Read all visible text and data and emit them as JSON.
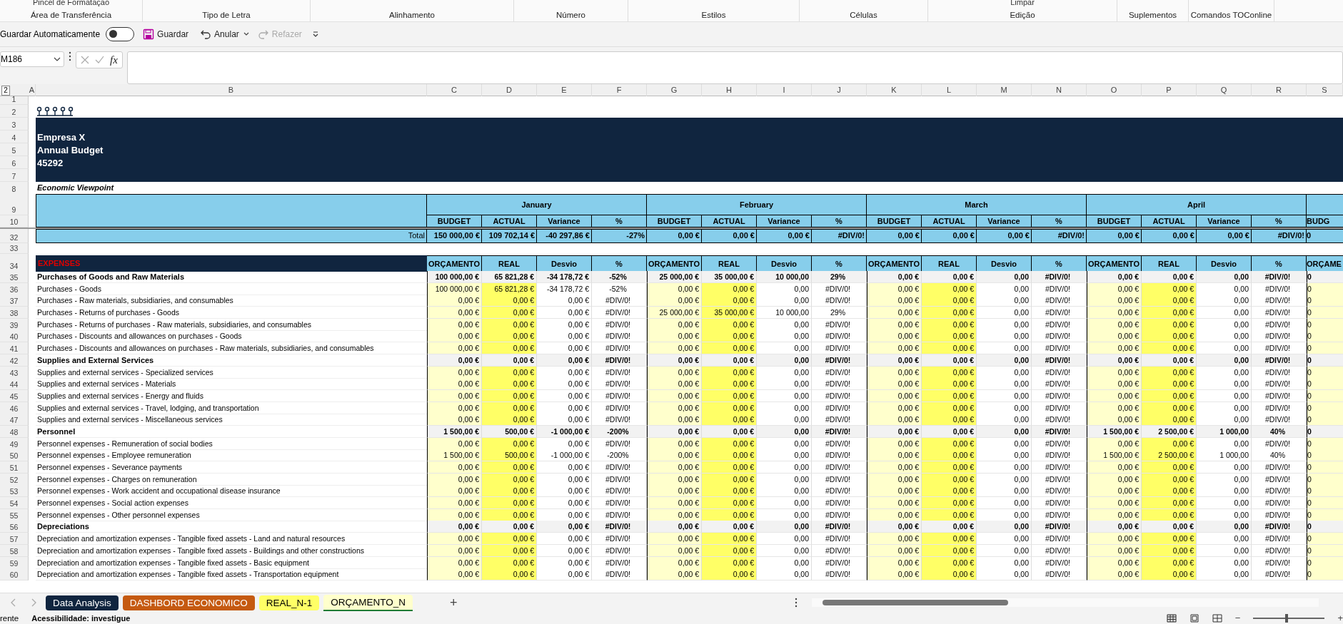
{
  "ribbon": {
    "groups": [
      {
        "label": "Área de Transferência",
        "top_label": "Pincel de Formatação"
      },
      {
        "label": "Tipo de Letra"
      },
      {
        "label": "Alinhamento"
      },
      {
        "label": "Número"
      },
      {
        "label": "Estilos"
      },
      {
        "label": "Células"
      },
      {
        "label": "Edição",
        "top_label": "Limpar"
      },
      {
        "label": "Suplementos"
      },
      {
        "label": "Comandos TOConline"
      }
    ]
  },
  "quick_access": {
    "autosave_label": "Guardar Automaticamente",
    "autosave_on": false,
    "save": "Guardar",
    "undo": "Anular",
    "redo": "Refazer",
    "redo_disabled": true
  },
  "formula_bar": {
    "name_box": "M186",
    "fx": "fx"
  },
  "outline_level": "2",
  "columns": [
    "A",
    "B",
    "C",
    "D",
    "E",
    "F",
    "G",
    "H",
    "I",
    "J",
    "K",
    "L",
    "M",
    "N",
    "O",
    "P",
    "Q",
    "R",
    "S"
  ],
  "top_rows": [
    {
      "number": "1",
      "kind": "blank"
    },
    {
      "number": "2",
      "kind": "logo"
    },
    {
      "number": "3",
      "kind": "banner"
    },
    {
      "number": "4",
      "kind": "banner",
      "text": "Empresa X"
    },
    {
      "number": "5",
      "kind": "banner",
      "text": "Annual Budget"
    },
    {
      "number": "6",
      "kind": "banner",
      "text": "45292"
    },
    {
      "number": "7",
      "kind": "banner"
    },
    {
      "number": "8",
      "kind": "caption",
      "text": "Economic Viewpoint"
    }
  ],
  "month_header": {
    "number": "9",
    "months": [
      "January",
      "February",
      "March",
      "April"
    ]
  },
  "sub_header": {
    "number": "10",
    "cells": [
      "BUDGET",
      "ACTUAL",
      "Variance",
      "%",
      "BUDGET",
      "ACTUAL",
      "Variance",
      "%",
      "BUDGET",
      "ACTUAL",
      "Variance",
      "%",
      "BUDGET",
      "ACTUAL",
      "Variance",
      "%",
      "BUDG"
    ]
  },
  "total_row": {
    "number": "32",
    "label": "Total",
    "cells": [
      "150 000,00 €",
      "109 702,14 €",
      "-40 297,86 €",
      "-27%",
      "0,00 €",
      "0,00 €",
      "0,00 €",
      "#DIV/0!",
      "0,00 €",
      "0,00 €",
      "0,00 €",
      "#DIV/0!",
      "0,00 €",
      "0,00 €",
      "0,00 €",
      "#DIV/0!",
      "0"
    ]
  },
  "blank_row": {
    "number": "33"
  },
  "expenses_header": {
    "number": "34",
    "label": "EXPENSES",
    "cells": [
      "ORÇAMENTO",
      "REAL",
      "Desvio",
      "%",
      "ORÇAMENTO",
      "REAL",
      "Desvio",
      "%",
      "ORÇAMENTO",
      "REAL",
      "Desvio",
      "%",
      "ORÇAMENTO",
      "REAL",
      "Desvio",
      "%",
      "ORÇAME"
    ]
  },
  "rows": [
    {
      "number": "35",
      "kind": "group",
      "label": "Purchases of Goods and Raw Materials",
      "cells": [
        "100 000,00 €",
        "65 821,28 €",
        "-34 178,72 €",
        "-52%",
        "25 000,00 €",
        "35 000,00 €",
        "10 000,00",
        "29%",
        "0,00 €",
        "0,00 €",
        "0,00",
        "#DIV/0!",
        "0,00 €",
        "0,00 €",
        "0,00",
        "#DIV/0!",
        "0"
      ]
    },
    {
      "number": "36",
      "kind": "item",
      "label": "Purchases - Goods",
      "cells": [
        "100 000,00 €",
        "65 821,28 €",
        "-34 178,72 €",
        "-52%",
        "0,00 €",
        "0,00 €",
        "0,00",
        "#DIV/0!",
        "0,00 €",
        "0,00 €",
        "0,00",
        "#DIV/0!",
        "0,00 €",
        "0,00 €",
        "0,00",
        "#DIV/0!",
        "0"
      ]
    },
    {
      "number": "37",
      "kind": "item",
      "label": "Purchases - Raw materials, subsidiaries, and consumables",
      "cells": [
        "0,00 €",
        "0,00 €",
        "0,00 €",
        "#DIV/0!",
        "0,00 €",
        "0,00 €",
        "0,00",
        "#DIV/0!",
        "0,00 €",
        "0,00 €",
        "0,00",
        "#DIV/0!",
        "0,00 €",
        "0,00 €",
        "0,00",
        "#DIV/0!",
        "0"
      ]
    },
    {
      "number": "38",
      "kind": "item",
      "label": "Purchases - Returns of purchases - Goods",
      "cells": [
        "0,00 €",
        "0,00 €",
        "0,00 €",
        "#DIV/0!",
        "25 000,00 €",
        "35 000,00 €",
        "10 000,00",
        "29%",
        "0,00 €",
        "0,00 €",
        "0,00",
        "#DIV/0!",
        "0,00 €",
        "0,00 €",
        "0,00",
        "#DIV/0!",
        "0"
      ]
    },
    {
      "number": "39",
      "kind": "item",
      "label": "Purchases - Returns of purchases - Raw materials, subsidiaries, and consumables",
      "cells": [
        "0,00 €",
        "0,00 €",
        "0,00 €",
        "#DIV/0!",
        "0,00 €",
        "0,00 €",
        "0,00",
        "#DIV/0!",
        "0,00 €",
        "0,00 €",
        "0,00",
        "#DIV/0!",
        "0,00 €",
        "0,00 €",
        "0,00",
        "#DIV/0!",
        "0"
      ]
    },
    {
      "number": "40",
      "kind": "item",
      "label": "Purchases - Discounts and allowances on purchases - Goods",
      "cells": [
        "0,00 €",
        "0,00 €",
        "0,00 €",
        "#DIV/0!",
        "0,00 €",
        "0,00 €",
        "0,00",
        "#DIV/0!",
        "0,00 €",
        "0,00 €",
        "0,00",
        "#DIV/0!",
        "0,00 €",
        "0,00 €",
        "0,00",
        "#DIV/0!",
        "0"
      ]
    },
    {
      "number": "41",
      "kind": "item",
      "label": "Purchases - Discounts and allowances on purchases - Raw materials, subsidiaries, and consumables",
      "cells": [
        "0,00 €",
        "0,00 €",
        "0,00 €",
        "#DIV/0!",
        "0,00 €",
        "0,00 €",
        "0,00",
        "#DIV/0!",
        "0,00 €",
        "0,00 €",
        "0,00",
        "#DIV/0!",
        "0,00 €",
        "0,00 €",
        "0,00",
        "#DIV/0!",
        "0"
      ]
    },
    {
      "number": "42",
      "kind": "group",
      "label": "Supplies and External Services",
      "cells": [
        "0,00 €",
        "0,00 €",
        "0,00 €",
        "#DIV/0!",
        "0,00 €",
        "0,00 €",
        "0,00",
        "#DIV/0!",
        "0,00 €",
        "0,00 €",
        "0,00",
        "#DIV/0!",
        "0,00 €",
        "0,00 €",
        "0,00",
        "#DIV/0!",
        "0"
      ]
    },
    {
      "number": "43",
      "kind": "item",
      "label": "Supplies and external services - Specialized services",
      "cells": [
        "0,00 €",
        "0,00 €",
        "0,00 €",
        "#DIV/0!",
        "0,00 €",
        "0,00 €",
        "0,00",
        "#DIV/0!",
        "0,00 €",
        "0,00 €",
        "0,00",
        "#DIV/0!",
        "0,00 €",
        "0,00 €",
        "0,00",
        "#DIV/0!",
        "0"
      ]
    },
    {
      "number": "44",
      "kind": "item",
      "label": "Supplies and external services - Materials",
      "cells": [
        "0,00 €",
        "0,00 €",
        "0,00 €",
        "#DIV/0!",
        "0,00 €",
        "0,00 €",
        "0,00",
        "#DIV/0!",
        "0,00 €",
        "0,00 €",
        "0,00",
        "#DIV/0!",
        "0,00 €",
        "0,00 €",
        "0,00",
        "#DIV/0!",
        "0"
      ]
    },
    {
      "number": "45",
      "kind": "item",
      "label": "Supplies and external services - Energy and fluids",
      "cells": [
        "0,00 €",
        "0,00 €",
        "0,00 €",
        "#DIV/0!",
        "0,00 €",
        "0,00 €",
        "0,00",
        "#DIV/0!",
        "0,00 €",
        "0,00 €",
        "0,00",
        "#DIV/0!",
        "0,00 €",
        "0,00 €",
        "0,00",
        "#DIV/0!",
        "0"
      ]
    },
    {
      "number": "46",
      "kind": "item",
      "label": "Supplies and external services - Travel, lodging, and transportation",
      "cells": [
        "0,00 €",
        "0,00 €",
        "0,00 €",
        "#DIV/0!",
        "0,00 €",
        "0,00 €",
        "0,00",
        "#DIV/0!",
        "0,00 €",
        "0,00 €",
        "0,00",
        "#DIV/0!",
        "0,00 €",
        "0,00 €",
        "0,00",
        "#DIV/0!",
        "0"
      ]
    },
    {
      "number": "47",
      "kind": "item",
      "label": "Supplies and external services - Miscellaneous services",
      "cells": [
        "0,00 €",
        "0,00 €",
        "0,00 €",
        "#DIV/0!",
        "0,00 €",
        "0,00 €",
        "0,00",
        "#DIV/0!",
        "0,00 €",
        "0,00 €",
        "0,00",
        "#DIV/0!",
        "0,00 €",
        "0,00 €",
        "0,00",
        "#DIV/0!",
        "0"
      ]
    },
    {
      "number": "48",
      "kind": "group",
      "label": "Personnel",
      "cells": [
        "1 500,00 €",
        "500,00 €",
        "-1 000,00 €",
        "-200%",
        "0,00 €",
        "0,00 €",
        "0,00",
        "#DIV/0!",
        "0,00 €",
        "0,00 €",
        "0,00",
        "#DIV/0!",
        "1 500,00 €",
        "2 500,00 €",
        "1 000,00",
        "40%",
        "0"
      ]
    },
    {
      "number": "49",
      "kind": "item",
      "label": "Personnel expenses - Remuneration of social bodies",
      "cells": [
        "0,00 €",
        "0,00 €",
        "0,00 €",
        "#DIV/0!",
        "0,00 €",
        "0,00 €",
        "0,00",
        "#DIV/0!",
        "0,00 €",
        "0,00 €",
        "0,00",
        "#DIV/0!",
        "0,00 €",
        "0,00 €",
        "0,00",
        "#DIV/0!",
        "0"
      ]
    },
    {
      "number": "50",
      "kind": "item",
      "label": "Personnel expenses - Employee remuneration",
      "cells": [
        "1 500,00 €",
        "500,00 €",
        "-1 000,00 €",
        "-200%",
        "0,00 €",
        "0,00 €",
        "0,00",
        "#DIV/0!",
        "0,00 €",
        "0,00 €",
        "0,00",
        "#DIV/0!",
        "1 500,00 €",
        "2 500,00 €",
        "1 000,00",
        "40%",
        "0"
      ]
    },
    {
      "number": "51",
      "kind": "item",
      "label": "Personnel expenses - Severance payments",
      "cells": [
        "0,00 €",
        "0,00 €",
        "0,00 €",
        "#DIV/0!",
        "0,00 €",
        "0,00 €",
        "0,00",
        "#DIV/0!",
        "0,00 €",
        "0,00 €",
        "0,00",
        "#DIV/0!",
        "0,00 €",
        "0,00 €",
        "0,00",
        "#DIV/0!",
        "0"
      ]
    },
    {
      "number": "52",
      "kind": "item",
      "label": "Personnel expenses - Charges on remuneration",
      "cells": [
        "0,00 €",
        "0,00 €",
        "0,00 €",
        "#DIV/0!",
        "0,00 €",
        "0,00 €",
        "0,00",
        "#DIV/0!",
        "0,00 €",
        "0,00 €",
        "0,00",
        "#DIV/0!",
        "0,00 €",
        "0,00 €",
        "0,00",
        "#DIV/0!",
        "0"
      ]
    },
    {
      "number": "53",
      "kind": "item",
      "label": "Personnel expenses - Work accident and occupational disease insurance",
      "cells": [
        "0,00 €",
        "0,00 €",
        "0,00 €",
        "#DIV/0!",
        "0,00 €",
        "0,00 €",
        "0,00",
        "#DIV/0!",
        "0,00 €",
        "0,00 €",
        "0,00",
        "#DIV/0!",
        "0,00 €",
        "0,00 €",
        "0,00",
        "#DIV/0!",
        "0"
      ]
    },
    {
      "number": "54",
      "kind": "item",
      "label": "Personnel expenses - Social action expenses",
      "cells": [
        "0,00 €",
        "0,00 €",
        "0,00 €",
        "#DIV/0!",
        "0,00 €",
        "0,00 €",
        "0,00",
        "#DIV/0!",
        "0,00 €",
        "0,00 €",
        "0,00",
        "#DIV/0!",
        "0,00 €",
        "0,00 €",
        "0,00",
        "#DIV/0!",
        "0"
      ]
    },
    {
      "number": "55",
      "kind": "item",
      "label": "Personnel expenses - Other personnel expenses",
      "cells": [
        "0,00 €",
        "0,00 €",
        "0,00 €",
        "#DIV/0!",
        "0,00 €",
        "0,00 €",
        "0,00",
        "#DIV/0!",
        "0,00 €",
        "0,00 €",
        "0,00",
        "#DIV/0!",
        "0,00 €",
        "0,00 €",
        "0,00",
        "#DIV/0!",
        "0"
      ]
    },
    {
      "number": "56",
      "kind": "group",
      "label": "Depreciations",
      "cells": [
        "0,00 €",
        "0,00 €",
        "0,00 €",
        "#DIV/0!",
        "0,00 €",
        "0,00 €",
        "0,00",
        "#DIV/0!",
        "0,00 €",
        "0,00 €",
        "0,00",
        "#DIV/0!",
        "0,00 €",
        "0,00 €",
        "0,00",
        "#DIV/0!",
        "0"
      ]
    },
    {
      "number": "57",
      "kind": "item",
      "label": "Depreciation and amortization expenses - Tangible fixed assets - Land and natural resources",
      "cells": [
        "0,00 €",
        "0,00 €",
        "0,00 €",
        "#DIV/0!",
        "0,00 €",
        "0,00 €",
        "0,00",
        "#DIV/0!",
        "0,00 €",
        "0,00 €",
        "0,00",
        "#DIV/0!",
        "0,00 €",
        "0,00 €",
        "0,00",
        "#DIV/0!",
        "0"
      ]
    },
    {
      "number": "58",
      "kind": "item",
      "label": "Depreciation and amortization expenses - Tangible fixed assets - Buildings and other constructions",
      "cells": [
        "0,00 €",
        "0,00 €",
        "0,00 €",
        "#DIV/0!",
        "0,00 €",
        "0,00 €",
        "0,00",
        "#DIV/0!",
        "0,00 €",
        "0,00 €",
        "0,00",
        "#DIV/0!",
        "0,00 €",
        "0,00 €",
        "0,00",
        "#DIV/0!",
        "0"
      ]
    },
    {
      "number": "59",
      "kind": "item",
      "label": "Depreciation and amortization expenses - Tangible fixed assets - Basic equipment",
      "cells": [
        "0,00 €",
        "0,00 €",
        "0,00 €",
        "#DIV/0!",
        "0,00 €",
        "0,00 €",
        "0,00",
        "#DIV/0!",
        "0,00 €",
        "0,00 €",
        "0,00",
        "#DIV/0!",
        "0,00 €",
        "0,00 €",
        "0,00",
        "#DIV/0!",
        "0"
      ]
    },
    {
      "number": "60",
      "kind": "item",
      "label": "Depreciation and amortization expenses - Tangible fixed assets - Transportation equipment",
      "cells": [
        "0,00 €",
        "0,00 €",
        "0,00 €",
        "#DIV/0!",
        "0,00 €",
        "0,00 €",
        "0,00",
        "#DIV/0!",
        "0,00 €",
        "0,00 €",
        "0,00",
        "#DIV/0!",
        "0,00 €",
        "0,00 €",
        "0,00",
        "#DIV/0!",
        "0"
      ]
    }
  ],
  "sheet_tabs": [
    {
      "label": "Data Analysis",
      "color": "#10253f",
      "selected": false
    },
    {
      "label": "DASHBORD ECONOMICO",
      "color": "#c55a11",
      "selected": false
    },
    {
      "label": "REAL_N-1",
      "color": "#ffff66",
      "selected": false
    },
    {
      "label": "ORÇAMENTO_N",
      "color": "#ffffcc",
      "selected": true
    }
  ],
  "add_sheet": "+",
  "status_bar": {
    "mode": "rente",
    "accessibility": "Acessibilidade: investigue",
    "zoom_out": "−",
    "zoom_in": "+",
    "zoom_slider": {
      "level": 0.45
    }
  }
}
